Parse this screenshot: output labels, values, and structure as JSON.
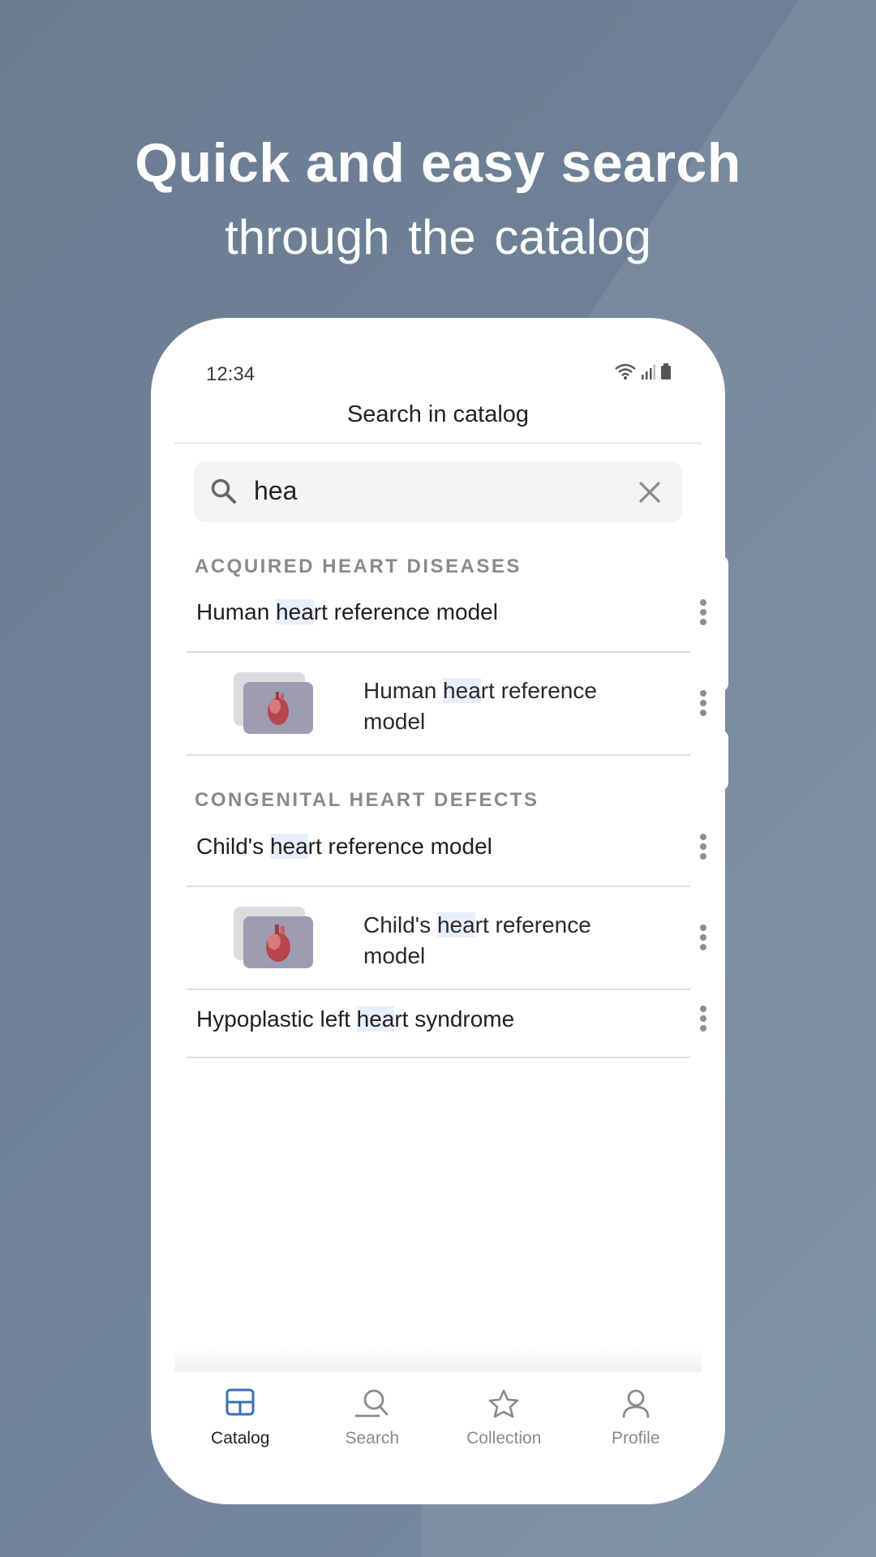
{
  "promo": {
    "headline": "Quick and easy search",
    "subline": "through  the catalog"
  },
  "status_bar": {
    "time": "12:34"
  },
  "topbar": {
    "title": "Search in catalog"
  },
  "search": {
    "value": "hea",
    "clear_icon": "close-icon",
    "search_icon": "search-icon"
  },
  "sections": [
    {
      "header": "ACQUIRED HEART DISEASES",
      "group_title": {
        "pre": "Human ",
        "hl": "hea",
        "post": "rt reference model"
      },
      "item": {
        "line1_pre": "Human ",
        "line1_hl": "hea",
        "line1_post": "rt reference",
        "line2": "model"
      }
    },
    {
      "header": "CONGENITAL HEART DEFECTS",
      "group_title": {
        "pre": "Child's ",
        "hl": "hea",
        "post": "rt reference model"
      },
      "item": {
        "line1_pre": "Child's ",
        "line1_hl": "hea",
        "line1_post": "rt reference",
        "line2": "model"
      }
    }
  ],
  "extra_row": {
    "pre": "Hypoplastic left ",
    "hl": "hea",
    "post": "rt syndrome"
  },
  "tabs": [
    {
      "label": "Catalog",
      "icon": "catalog-icon",
      "active": true
    },
    {
      "label": "Search",
      "icon": "search-icon",
      "active": false
    },
    {
      "label": "Collection",
      "icon": "star-icon",
      "active": false
    },
    {
      "label": "Profile",
      "icon": "profile-icon",
      "active": false
    }
  ],
  "colors": {
    "accent": "#3d6fb6",
    "highlight": "#e7eefc"
  }
}
